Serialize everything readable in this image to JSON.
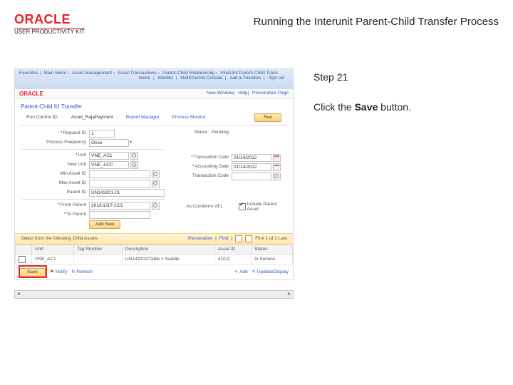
{
  "brandLogo": "ORACLE",
  "brandSub": "USER PRODUCTIVITY KIT",
  "pageTitle": "Running the Interunit Parent-Child Transfer Process",
  "stepLabel": "Step 21",
  "instruction": {
    "pre": "Click the ",
    "bold": "Save",
    "post": " button."
  },
  "topbar": {
    "crumbs": [
      "Favorites",
      "Main Menu",
      "Asset Management",
      "Asset Transactions",
      "Parent-Child Relationship",
      "InterUnit Parent-Child Trans"
    ],
    "links": [
      "Home",
      "Worklist",
      "MultiChannel Console",
      "Add to Favorites",
      "Sign out"
    ]
  },
  "miniBrand": "ORACLE",
  "miniRight": [
    "New Window",
    "Help",
    "Personalize Page"
  ],
  "panelTitle": "Parent-Child IU Transfer",
  "sub": {
    "runCtrlLbl": "Run Control ID:",
    "runCtrlVal": "Asset_RajaPayment",
    "repMgr": "Report Manager",
    "procMon": "Process Monitor",
    "runBtn": "Run"
  },
  "requestIdLbl": "Request ID",
  "requestId": "1",
  "statusLbl": "Status:",
  "statusVal": "Pending",
  "procFreqLbl": "Process Frequency",
  "procFreq": "Once",
  "unitLbl": "Unit",
  "unitVal": "VNE_AC1",
  "newUnitLbl": "New Unit",
  "newUnitVal": "VNE_ACC",
  "transDateLbl": "Transaction Date",
  "transDateVal": "01/14/2012",
  "acctDateLbl": "Accounting Date",
  "acctDateVal": "01/14/2012",
  "transCodeLbl": "Transaction Code",
  "transCodeVal": "",
  "minAssetLbl": "Min Asset ID",
  "minAssetVal": "",
  "maxAssetLbl": "Max Asset ID",
  "maxAssetVal": "",
  "parentIdLbl": "Parent ID",
  "parentIdVal": "UN143201-01",
  "fromParLbl": "From Parent",
  "fromParVal": "201/ULI17-22/2",
  "autoCondLbl": "As Condemn VEL",
  "includeParentLbl": "Include Parent Asset",
  "toParLbl": "To Parent",
  "toParVal": "",
  "addNewBtn": "Add New",
  "selectBarTitle": "Select from the following Child Assets",
  "selectBarLinks": {
    "personalize": "Personalize",
    "find": "Find"
  },
  "paging": "First 1 of 1 Last",
  "table": {
    "headers": [
      "Unit",
      "Tag Number",
      "Description",
      "Asset ID",
      "Status"
    ],
    "row": [
      "VNE_AC1",
      "",
      "UN143201/Table + Saddle",
      "410-C",
      "In Service"
    ]
  },
  "actions": {
    "save": "Save",
    "notify": "Notify",
    "refresh": "Refresh",
    "add": "Add",
    "updateDisplay": "Update/Display"
  }
}
